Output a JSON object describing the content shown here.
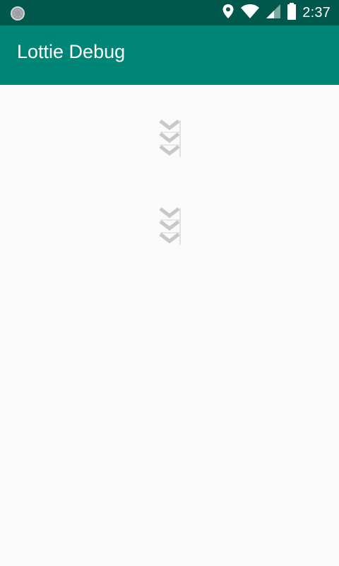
{
  "status_bar": {
    "time": "2:37",
    "icons": [
      "app-indicator-icon",
      "location-icon",
      "wifi-icon",
      "cell-signal-icon",
      "battery-icon"
    ],
    "background": "#00574b"
  },
  "app_bar": {
    "title": "Lottie Debug",
    "background": "#008577"
  },
  "content": {
    "background": "#fafafa",
    "animations": [
      {
        "name": "chevrons-animation-1",
        "icon": "triple-chevron-down-icon",
        "color": "#c8c8c8"
      },
      {
        "name": "chevrons-animation-2",
        "icon": "triple-chevron-down-icon",
        "color": "#c8c8c8"
      }
    ]
  }
}
